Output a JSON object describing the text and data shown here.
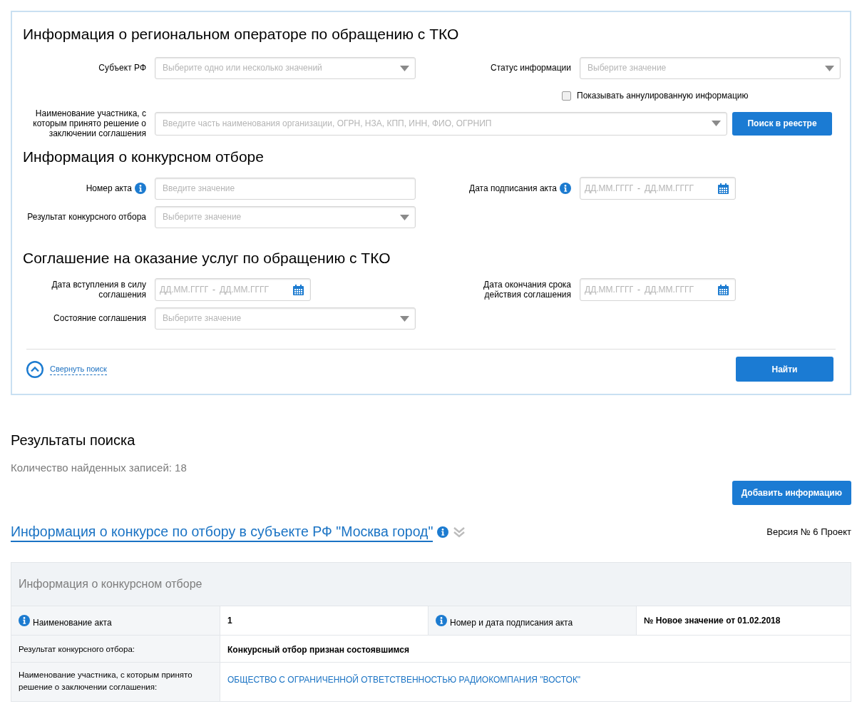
{
  "search_panel": {
    "sections": [
      {
        "title": "Информация о региональном операторе по обращению с ТКО",
        "rows": [
          {
            "kind": "pair",
            "left": {
              "label": "Субъект РФ",
              "kind": "select",
              "placeholder": "Выберите одно или несколько значений",
              "info": false
            },
            "right": {
              "label": "Статус информации",
              "kind": "select",
              "placeholder": "Выберите значение",
              "info": false
            }
          },
          {
            "kind": "checkbox",
            "label": "Показывать аннулированную информацию",
            "checked": false
          },
          {
            "kind": "search",
            "label": "Наименование участника, с которым принято решение о заключении соглашения",
            "placeholder": "Введите часть наименования организации, ОГРН, НЗА, КПП, ИНН, ФИО, ОГРНИП",
            "button": "Поиск в реестре"
          }
        ]
      },
      {
        "title": "Информация о конкурсном отборе",
        "rows": [
          {
            "kind": "pair",
            "left": {
              "label": "Номер акта",
              "kind": "text",
              "placeholder": "Введите значение",
              "info": true
            },
            "right": {
              "label": "Дата подписания акта",
              "kind": "date_range",
              "placeholder_from": "ДД.ММ.ГГГГ",
              "separator": "-",
              "placeholder_to": "ДД.ММ.ГГГГ",
              "info": true
            }
          },
          {
            "kind": "pair",
            "left": {
              "label": "Результат конкурсного отбора",
              "kind": "select",
              "placeholder": "Выберите значение",
              "info": false
            }
          }
        ]
      },
      {
        "title": "Соглашение на оказание услуг по обращению с ТКО",
        "rows": [
          {
            "kind": "pair",
            "left": {
              "label": "Дата вступления в силу соглашения",
              "kind": "date_range",
              "placeholder_from": "ДД.ММ.ГГГГ",
              "separator": "-",
              "placeholder_to": "ДД.ММ.ГГГГ",
              "info": false
            },
            "right": {
              "label": "Дата окончания срока действия соглашения",
              "kind": "date_range",
              "placeholder_from": "ДД.ММ.ГГГГ",
              "separator": "-",
              "placeholder_to": "ДД.ММ.ГГГГ",
              "info": false
            }
          },
          {
            "kind": "pair",
            "left": {
              "label": "Состояние соглашения",
              "kind": "select",
              "placeholder": "Выберите значение",
              "info": false
            }
          }
        ]
      }
    ],
    "collapse_link": "Свернуть поиск",
    "find_button": "Найти"
  },
  "results": {
    "title": "Результаты поиска",
    "count": "Количество найденных записей: 18",
    "add_button": "Добавить информацию",
    "record": {
      "title": "Информация о конкурсе по отбору в субъекте РФ \"Москва город\"",
      "version": "Версия № 6 Проект",
      "table": {
        "header": "Информация о конкурсном отборе",
        "rows": [
          {
            "cells": [
              {
                "kind": "label",
                "text": "Наименование акта",
                "info": true
              },
              {
                "kind": "value",
                "text": "1"
              },
              {
                "kind": "label",
                "text": "Номер и дата подписания акта",
                "info": true
              },
              {
                "kind": "value",
                "text": "№ Новое значение от 01.02.2018"
              }
            ]
          },
          {
            "cells": [
              {
                "kind": "label",
                "text": "Результат конкурсного отбора:",
                "info": false
              },
              {
                "kind": "value",
                "text": "Конкурсный отбор признан состоявшимся"
              }
            ]
          },
          {
            "cells": [
              {
                "kind": "label",
                "text": "Наименование участника, с которым принято решение о заключении соглашения:",
                "info": false
              },
              {
                "kind": "link",
                "text": "ОБЩЕСТВО С ОГРАНИЧЕННОЙ ОТВЕТСТВЕННОСТЬЮ РАДИОКОМПАНИЯ \"ВОСТОК\""
              }
            ]
          }
        ]
      }
    }
  }
}
